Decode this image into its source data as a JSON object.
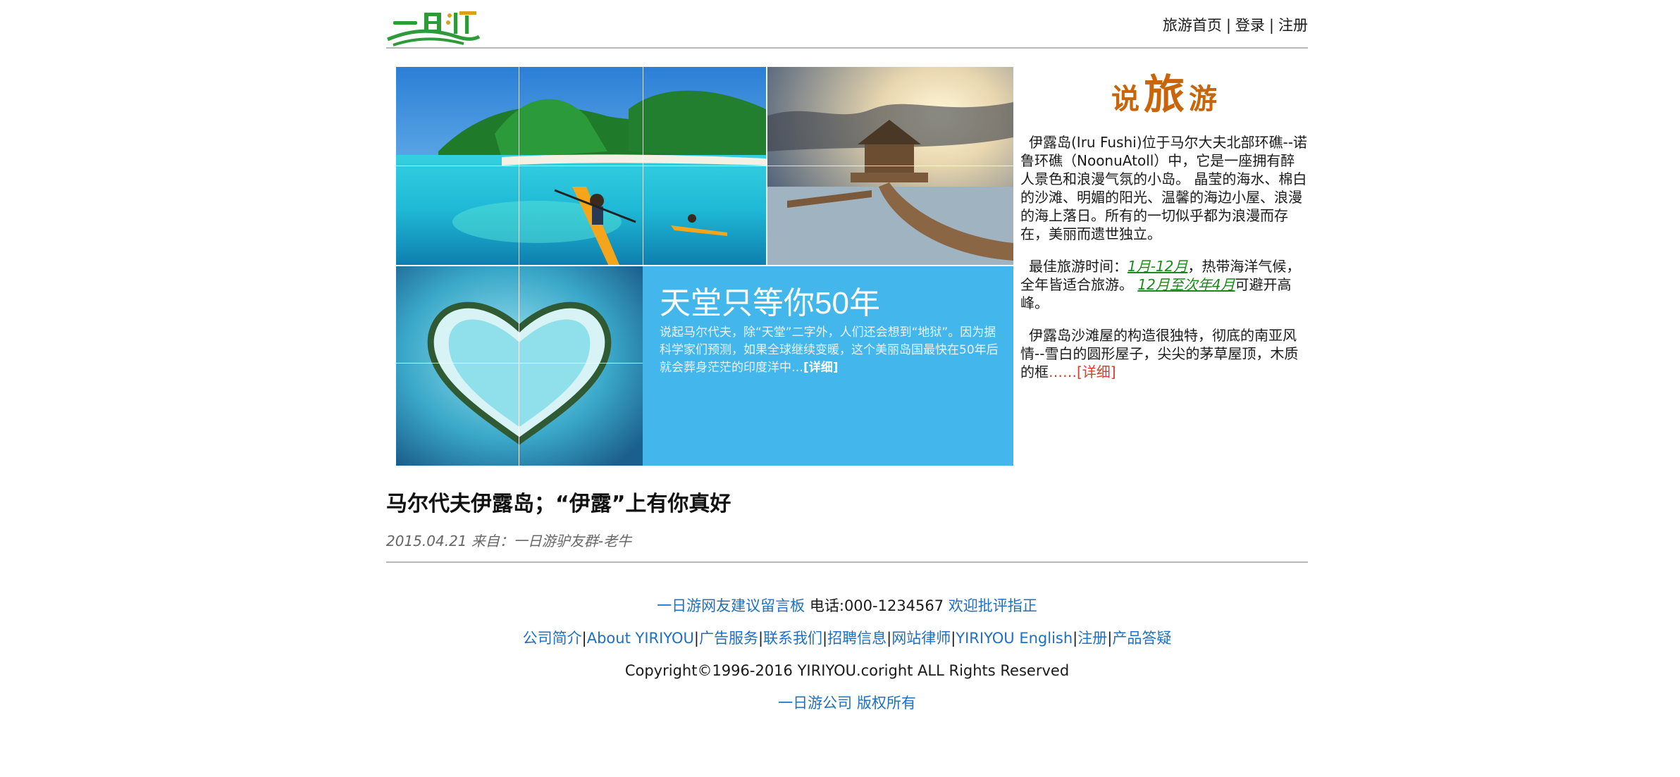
{
  "header": {
    "logo_text": "一日游",
    "nav": [
      "旅游首页",
      "登录",
      "注册"
    ]
  },
  "hero": {
    "headline": "天堂只等你50年",
    "body": "说起马尔代夫，除“天堂”二字外，人们还会想到“地狱”。因为据科学家们预测，如果全球继续变暖，这个美丽岛国最快在50年后就会葬身茫茫的印度洋中…",
    "more": "[详细]"
  },
  "side": {
    "title": [
      "说",
      "旅",
      "游"
    ],
    "p1": "伊露岛(Iru Fushi)位于马尔大夫北部环礁--诺鲁环礁（NoonuAtoll）中，它是一座拥有醉人景色和浪漫气氛的小岛。 晶莹的海水、棉白的沙滩、明媚的阳光、温馨的海边小屋、浪漫的海上落日。所有的一切似乎都为浪漫而存在，美丽而遗世独立。",
    "p2_a": "最佳旅游时间：",
    "p2_hl1": "1月-12月",
    "p2_b": "，热带海洋气候，全年皆适合旅游。 ",
    "p2_hl2": "12月至次年4月",
    "p2_c": "可避开高峰。",
    "p3": "伊露岛沙滩屋的构造很独特，彻底的南亚风情--雪白的圆形屋子，尖尖的茅草屋顶，木质的框",
    "p3_dots": "……",
    "p3_more": "[详细]"
  },
  "article": {
    "title": "马尔代夫伊露岛；“伊露”上有你真好",
    "meta": "2015.04.21 来自：一日游驴友群-老牛"
  },
  "footer": {
    "board": "一日游网友建议留言板",
    "phone": " 电话:000-1234567 ",
    "welcome": "欢迎批评指正",
    "links": [
      "公司简介",
      "About YIRIYOU",
      "广告服务",
      "联系我们",
      "招聘信息",
      "网站律师",
      "YIRIYOU English",
      "注册",
      "产品答疑"
    ],
    "copyright": "Copyright©1996-2016 YIRIYOU.coright ALL Rights Reserved",
    "owner": "一日游公司 版权所有"
  },
  "colors": {
    "accent": "#c8650a",
    "link": "#1f6fc2",
    "highlight": "#1b8a1b",
    "more": "#d0402a",
    "hero_panel": "#43b6ec"
  }
}
